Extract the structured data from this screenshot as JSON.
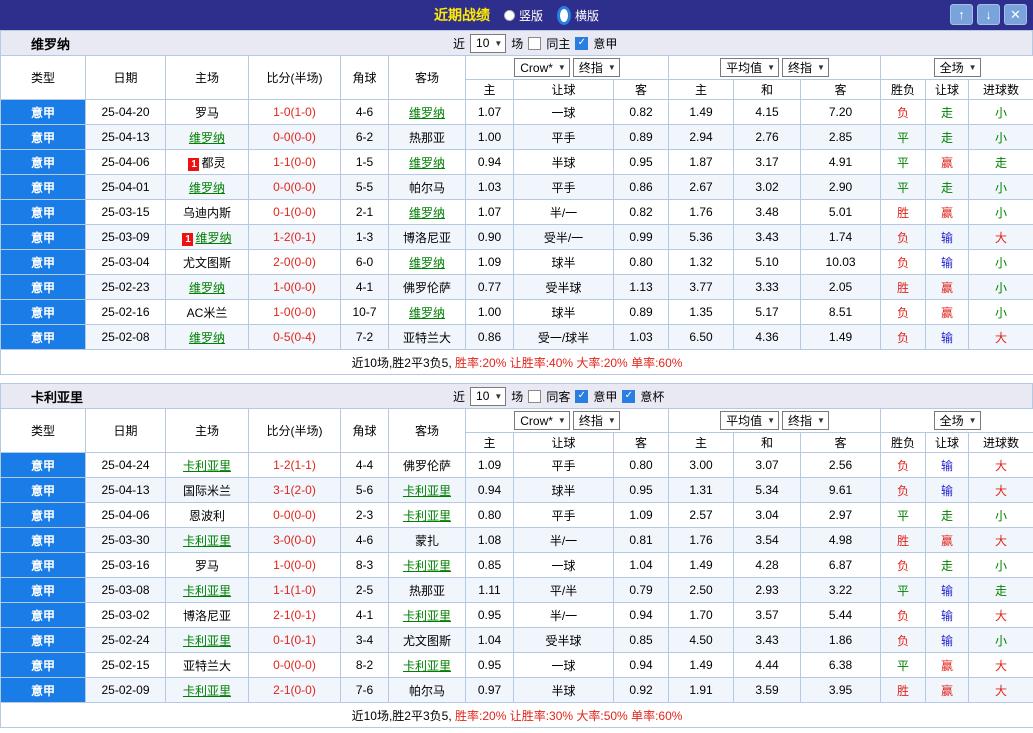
{
  "titlebar": {
    "title": "近期战绩",
    "radios": [
      {
        "label": "竖版",
        "selected": false
      },
      {
        "label": "横版",
        "selected": true
      }
    ],
    "buttons": {
      "up": "↑",
      "down": "↓",
      "close": "✕"
    }
  },
  "labels": {
    "near": "近",
    "games": "场"
  },
  "columns": {
    "main": [
      "类型",
      "日期",
      "主场",
      "比分(半场)",
      "角球",
      "客场"
    ],
    "sub": [
      "主",
      "让球",
      "客",
      "主",
      "和",
      "客",
      "胜负",
      "让球",
      "进球数"
    ],
    "selects": {
      "book": "Crow*",
      "final1": "终指",
      "avg": "平均值",
      "final2": "终指",
      "scope": "全场"
    }
  },
  "colors": {
    "accent_blue": "#1a7ce6",
    "red": "#e1251b",
    "green": "#008000",
    "blue": "#2222cc",
    "titlebar": "#2e2e8c",
    "title_yellow": "#ffeb00"
  },
  "sections": [
    {
      "team": "维罗纳",
      "filters": {
        "count": "10",
        "checks": [
          {
            "label": "同主",
            "checked": false
          },
          {
            "label": "意甲",
            "checked": true
          }
        ]
      },
      "rows": [
        {
          "league": "意甲",
          "date": "25-04-20",
          "home": "罗马",
          "home_card": false,
          "home_hl": false,
          "score": "1-0(1-0)",
          "corner": "4-6",
          "away": "维罗纳",
          "away_card": false,
          "away_hl": true,
          "odds": [
            "1.07",
            "一球",
            "0.82",
            "1.49",
            "4.15",
            "7.20"
          ],
          "results": [
            [
              "负",
              "r"
            ],
            [
              "走",
              "g"
            ],
            [
              "小",
              "g"
            ]
          ]
        },
        {
          "league": "意甲",
          "date": "25-04-13",
          "home": "维罗纳",
          "home_card": false,
          "home_hl": true,
          "score": "0-0(0-0)",
          "corner": "6-2",
          "away": "热那亚",
          "away_card": false,
          "away_hl": false,
          "odds": [
            "1.00",
            "平手",
            "0.89",
            "2.94",
            "2.76",
            "2.85"
          ],
          "results": [
            [
              "平",
              "g"
            ],
            [
              "走",
              "g"
            ],
            [
              "小",
              "g"
            ]
          ]
        },
        {
          "league": "意甲",
          "date": "25-04-06",
          "home": "都灵",
          "home_card": true,
          "home_hl": false,
          "score": "1-1(0-0)",
          "corner": "1-5",
          "away": "维罗纳",
          "away_card": false,
          "away_hl": true,
          "odds": [
            "0.94",
            "半球",
            "0.95",
            "1.87",
            "3.17",
            "4.91"
          ],
          "results": [
            [
              "平",
              "g"
            ],
            [
              "赢",
              "r"
            ],
            [
              "走",
              "g"
            ]
          ]
        },
        {
          "league": "意甲",
          "date": "25-04-01",
          "home": "维罗纳",
          "home_card": false,
          "home_hl": true,
          "score": "0-0(0-0)",
          "corner": "5-5",
          "away": "帕尔马",
          "away_card": false,
          "away_hl": false,
          "odds": [
            "1.03",
            "平手",
            "0.86",
            "2.67",
            "3.02",
            "2.90"
          ],
          "results": [
            [
              "平",
              "g"
            ],
            [
              "走",
              "g"
            ],
            [
              "小",
              "g"
            ]
          ]
        },
        {
          "league": "意甲",
          "date": "25-03-15",
          "home": "乌迪内斯",
          "home_card": false,
          "home_hl": false,
          "score": "0-1(0-0)",
          "corner": "2-1",
          "away": "维罗纳",
          "away_card": false,
          "away_hl": true,
          "odds": [
            "1.07",
            "半/一",
            "0.82",
            "1.76",
            "3.48",
            "5.01"
          ],
          "results": [
            [
              "胜",
              "r"
            ],
            [
              "赢",
              "r"
            ],
            [
              "小",
              "g"
            ]
          ]
        },
        {
          "league": "意甲",
          "date": "25-03-09",
          "home": "维罗纳",
          "home_card": true,
          "home_hl": true,
          "score": "1-2(0-1)",
          "corner": "1-3",
          "away": "博洛尼亚",
          "away_card": false,
          "away_hl": false,
          "odds": [
            "0.90",
            "受半/一",
            "0.99",
            "5.36",
            "3.43",
            "1.74"
          ],
          "results": [
            [
              "负",
              "r"
            ],
            [
              "输",
              "b"
            ],
            [
              "大",
              "r"
            ]
          ]
        },
        {
          "league": "意甲",
          "date": "25-03-04",
          "home": "尤文图斯",
          "home_card": false,
          "home_hl": false,
          "score": "2-0(0-0)",
          "corner": "6-0",
          "away": "维罗纳",
          "away_card": false,
          "away_hl": true,
          "odds": [
            "1.09",
            "球半",
            "0.80",
            "1.32",
            "5.10",
            "10.03"
          ],
          "results": [
            [
              "负",
              "r"
            ],
            [
              "输",
              "b"
            ],
            [
              "小",
              "g"
            ]
          ]
        },
        {
          "league": "意甲",
          "date": "25-02-23",
          "home": "维罗纳",
          "home_card": false,
          "home_hl": true,
          "score": "1-0(0-0)",
          "corner": "4-1",
          "away": "佛罗伦萨",
          "away_card": false,
          "away_hl": false,
          "odds": [
            "0.77",
            "受半球",
            "1.13",
            "3.77",
            "3.33",
            "2.05"
          ],
          "results": [
            [
              "胜",
              "r"
            ],
            [
              "赢",
              "r"
            ],
            [
              "小",
              "g"
            ]
          ]
        },
        {
          "league": "意甲",
          "date": "25-02-16",
          "home": "AC米兰",
          "home_card": false,
          "home_hl": false,
          "score": "1-0(0-0)",
          "corner": "10-7",
          "away": "维罗纳",
          "away_card": false,
          "away_hl": true,
          "odds": [
            "1.00",
            "球半",
            "0.89",
            "1.35",
            "5.17",
            "8.51"
          ],
          "results": [
            [
              "负",
              "r"
            ],
            [
              "赢",
              "r"
            ],
            [
              "小",
              "g"
            ]
          ]
        },
        {
          "league": "意甲",
          "date": "25-02-08",
          "home": "维罗纳",
          "home_card": false,
          "home_hl": true,
          "score": "0-5(0-4)",
          "corner": "7-2",
          "away": "亚特兰大",
          "away_card": false,
          "away_hl": false,
          "odds": [
            "0.86",
            "受一/球半",
            "1.03",
            "6.50",
            "4.36",
            "1.49"
          ],
          "results": [
            [
              "负",
              "r"
            ],
            [
              "输",
              "b"
            ],
            [
              "大",
              "r"
            ]
          ]
        }
      ],
      "summary_prefix": "近10场,胜2平3负5,",
      "summary_stats": " 胜率:20% 让胜率:40% 大率:20% 单率:60%"
    },
    {
      "team": "卡利亚里",
      "filters": {
        "count": "10",
        "checks": [
          {
            "label": "同客",
            "checked": false
          },
          {
            "label": "意甲",
            "checked": true
          },
          {
            "label": "意杯",
            "checked": true
          }
        ]
      },
      "rows": [
        {
          "league": "意甲",
          "date": "25-04-24",
          "home": "卡利亚里",
          "home_card": false,
          "home_hl": true,
          "score": "1-2(1-1)",
          "corner": "4-4",
          "away": "佛罗伦萨",
          "away_card": false,
          "away_hl": false,
          "odds": [
            "1.09",
            "平手",
            "0.80",
            "3.00",
            "3.07",
            "2.56"
          ],
          "results": [
            [
              "负",
              "r"
            ],
            [
              "输",
              "b"
            ],
            [
              "大",
              "r"
            ]
          ]
        },
        {
          "league": "意甲",
          "date": "25-04-13",
          "home": "国际米兰",
          "home_card": false,
          "home_hl": false,
          "score": "3-1(2-0)",
          "corner": "5-6",
          "away": "卡利亚里",
          "away_card": false,
          "away_hl": true,
          "odds": [
            "0.94",
            "球半",
            "0.95",
            "1.31",
            "5.34",
            "9.61"
          ],
          "results": [
            [
              "负",
              "r"
            ],
            [
              "输",
              "b"
            ],
            [
              "大",
              "r"
            ]
          ]
        },
        {
          "league": "意甲",
          "date": "25-04-06",
          "home": "恩波利",
          "home_card": false,
          "home_hl": false,
          "score": "0-0(0-0)",
          "corner": "2-3",
          "away": "卡利亚里",
          "away_card": false,
          "away_hl": true,
          "odds": [
            "0.80",
            "平手",
            "1.09",
            "2.57",
            "3.04",
            "2.97"
          ],
          "results": [
            [
              "平",
              "g"
            ],
            [
              "走",
              "g"
            ],
            [
              "小",
              "g"
            ]
          ]
        },
        {
          "league": "意甲",
          "date": "25-03-30",
          "home": "卡利亚里",
          "home_card": false,
          "home_hl": true,
          "score": "3-0(0-0)",
          "corner": "4-6",
          "away": "蒙扎",
          "away_card": false,
          "away_hl": false,
          "odds": [
            "1.08",
            "半/一",
            "0.81",
            "1.76",
            "3.54",
            "4.98"
          ],
          "results": [
            [
              "胜",
              "r"
            ],
            [
              "赢",
              "r"
            ],
            [
              "大",
              "r"
            ]
          ]
        },
        {
          "league": "意甲",
          "date": "25-03-16",
          "home": "罗马",
          "home_card": false,
          "home_hl": false,
          "score": "1-0(0-0)",
          "corner": "8-3",
          "away": "卡利亚里",
          "away_card": false,
          "away_hl": true,
          "odds": [
            "0.85",
            "一球",
            "1.04",
            "1.49",
            "4.28",
            "6.87"
          ],
          "results": [
            [
              "负",
              "r"
            ],
            [
              "走",
              "g"
            ],
            [
              "小",
              "g"
            ]
          ]
        },
        {
          "league": "意甲",
          "date": "25-03-08",
          "home": "卡利亚里",
          "home_card": false,
          "home_hl": true,
          "score": "1-1(1-0)",
          "corner": "2-5",
          "away": "热那亚",
          "away_card": false,
          "away_hl": false,
          "odds": [
            "1.11",
            "平/半",
            "0.79",
            "2.50",
            "2.93",
            "3.22"
          ],
          "results": [
            [
              "平",
              "g"
            ],
            [
              "输",
              "b"
            ],
            [
              "走",
              "g"
            ]
          ]
        },
        {
          "league": "意甲",
          "date": "25-03-02",
          "home": "博洛尼亚",
          "home_card": false,
          "home_hl": false,
          "score": "2-1(0-1)",
          "corner": "4-1",
          "away": "卡利亚里",
          "away_card": false,
          "away_hl": true,
          "odds": [
            "0.95",
            "半/一",
            "0.94",
            "1.70",
            "3.57",
            "5.44"
          ],
          "results": [
            [
              "负",
              "r"
            ],
            [
              "输",
              "b"
            ],
            [
              "大",
              "r"
            ]
          ]
        },
        {
          "league": "意甲",
          "date": "25-02-24",
          "home": "卡利亚里",
          "home_card": false,
          "home_hl": true,
          "score": "0-1(0-1)",
          "corner": "3-4",
          "away": "尤文图斯",
          "away_card": false,
          "away_hl": false,
          "odds": [
            "1.04",
            "受半球",
            "0.85",
            "4.50",
            "3.43",
            "1.86"
          ],
          "results": [
            [
              "负",
              "r"
            ],
            [
              "输",
              "b"
            ],
            [
              "小",
              "g"
            ]
          ]
        },
        {
          "league": "意甲",
          "date": "25-02-15",
          "home": "亚特兰大",
          "home_card": false,
          "home_hl": false,
          "score": "0-0(0-0)",
          "corner": "8-2",
          "away": "卡利亚里",
          "away_card": false,
          "away_hl": true,
          "odds": [
            "0.95",
            "一球",
            "0.94",
            "1.49",
            "4.44",
            "6.38"
          ],
          "results": [
            [
              "平",
              "g"
            ],
            [
              "赢",
              "r"
            ],
            [
              "大",
              "r"
            ]
          ]
        },
        {
          "league": "意甲",
          "date": "25-02-09",
          "home": "卡利亚里",
          "home_card": false,
          "home_hl": true,
          "score": "2-1(0-0)",
          "corner": "7-6",
          "away": "帕尔马",
          "away_card": false,
          "away_hl": false,
          "odds": [
            "0.97",
            "半球",
            "0.92",
            "1.91",
            "3.59",
            "3.95"
          ],
          "results": [
            [
              "胜",
              "r"
            ],
            [
              "赢",
              "r"
            ],
            [
              "大",
              "r"
            ]
          ]
        }
      ],
      "summary_prefix": "近10场,胜2平3负5,",
      "summary_stats": " 胜率:20% 让胜率:30% 大率:50% 单率:60%"
    }
  ]
}
